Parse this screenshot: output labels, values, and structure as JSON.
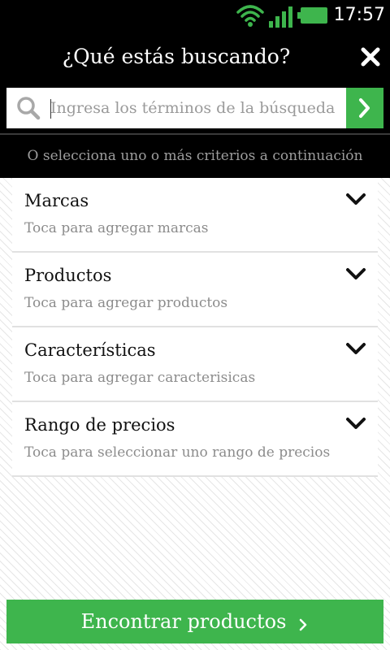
{
  "status_bar": {
    "time": "17:57",
    "icons": [
      "wifi-icon",
      "signal-icon",
      "battery-icon"
    ],
    "accent_color": "#3eb54d"
  },
  "header": {
    "title": "¿Qué estás buscando?",
    "close_icon": "close-icon"
  },
  "search": {
    "placeholder": "Ingresa los términos de la búsqueda",
    "value": "",
    "submit_icon": "chevron-right-icon"
  },
  "criteria_hint": "O selecciona uno o más criterios a continuación",
  "filters": [
    {
      "title": "Marcas",
      "subtitle": "Toca para agregar marcas"
    },
    {
      "title": "Productos",
      "subtitle": "Toca para agregar productos"
    },
    {
      "title": "Características",
      "subtitle": "Toca para agregar caracterisicas"
    },
    {
      "title": "Rango de precios",
      "subtitle": "Toca para seleccionar uno rango de precios"
    }
  ],
  "find_button": {
    "label": "Encontrar productos",
    "color": "#3eb54d"
  }
}
